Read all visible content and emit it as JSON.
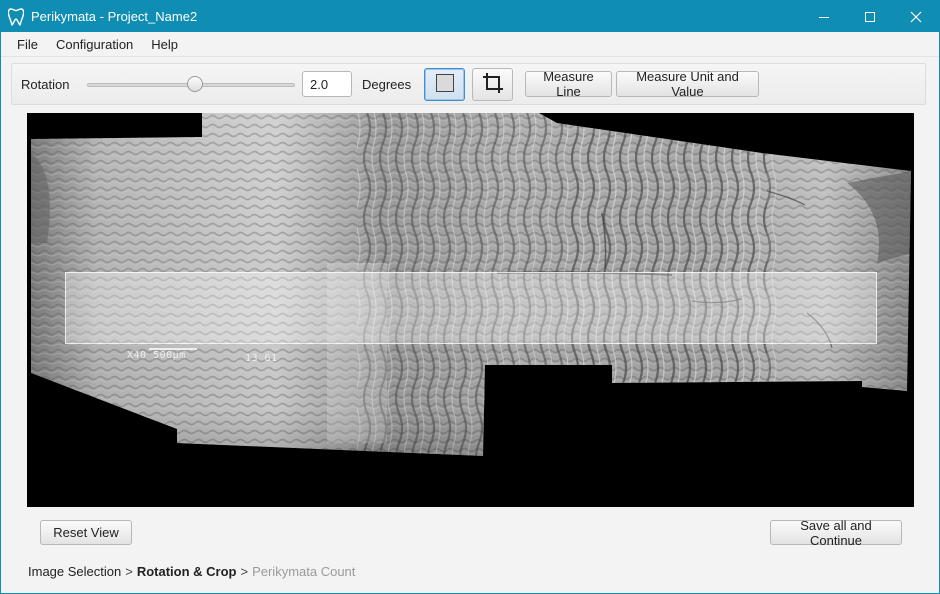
{
  "window": {
    "title": "Perikymata - Project_Name2",
    "controls": {
      "minimize_icon": "minimize-icon",
      "maximize_icon": "maximize-icon",
      "close_icon": "close-icon"
    },
    "accent_color": "#0f8db3"
  },
  "menu": {
    "items": [
      "File",
      "Configuration",
      "Help"
    ]
  },
  "toolbar": {
    "rotation_label": "Rotation",
    "rotation_slider_fraction": 0.52,
    "rotation_value": "2.0",
    "degrees_label": "Degrees",
    "select_tool_icon": "square-select-icon",
    "crop_tool_icon": "crop-icon",
    "measure_line_label": "Measure Line",
    "measure_unit_label": "Measure Unit and Value"
  },
  "viewer": {
    "scale_text": "X40  500µm",
    "image_code": "13 61"
  },
  "footer": {
    "reset_label": "Reset View",
    "save_label": "Save all and Continue"
  },
  "breadcrumb": {
    "steps": [
      "Image Selection",
      "Rotation & Crop",
      "Perikymata Count"
    ],
    "separator": ">"
  }
}
